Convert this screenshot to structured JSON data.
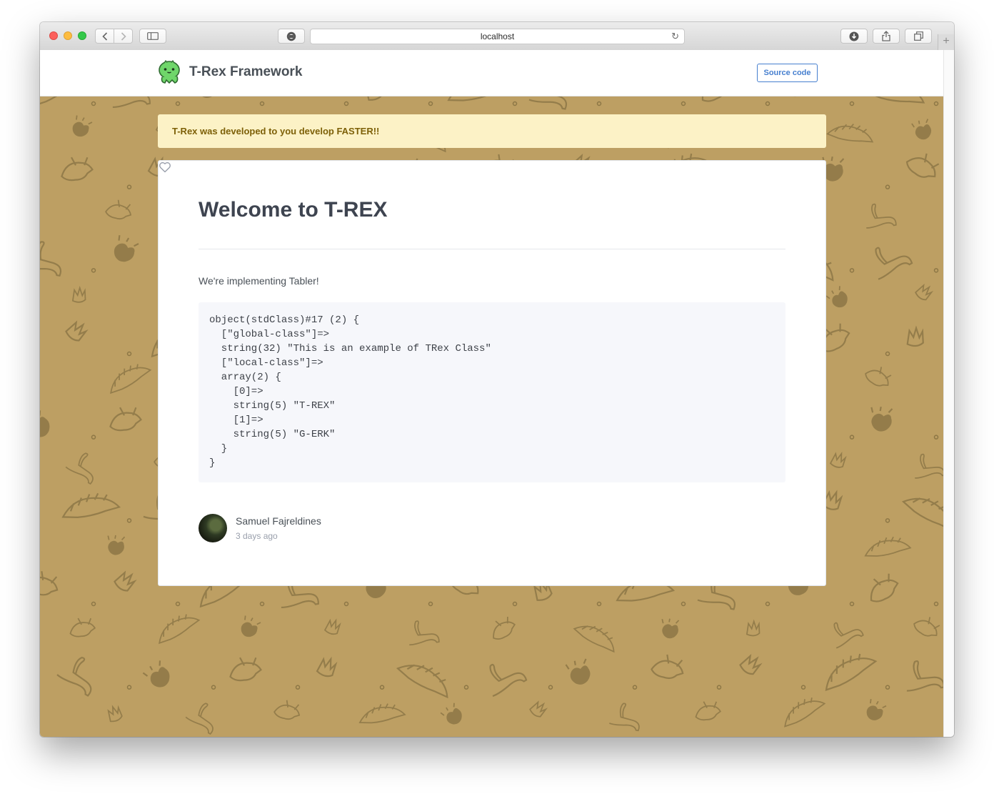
{
  "browser": {
    "url": "localhost",
    "icons": [
      "back-icon",
      "forward-icon",
      "sidebar-icon",
      "reader-icon",
      "reload-icon",
      "download-icon",
      "share-icon",
      "tabs-icon",
      "new-tab-icon"
    ]
  },
  "header": {
    "brand_name": "T-Rex Framework",
    "source_button": "Source code"
  },
  "alert": {
    "text": "T-Rex was developed to you develop FASTER!!"
  },
  "card": {
    "title": "Welcome to T-REX",
    "intro": "We're implementing Tabler!",
    "code": "object(stdClass)#17 (2) {\n  [\"global-class\"]=>\n  string(32) \"This is an example of TRex Class\"\n  [\"local-class\"]=>\n  array(2) {\n    [0]=>\n    string(5) \"T-REX\"\n    [1]=>\n    string(5) \"G-ERK\"\n  }\n}",
    "author_name": "Samuel Fajreldines",
    "author_time": "3 days ago"
  },
  "colors": {
    "background_pattern": "#bd9f63",
    "pattern_stroke": "#8d7746",
    "alert_bg": "#fcf2c6",
    "alert_text": "#7d6008",
    "accent": "#467fcf"
  }
}
